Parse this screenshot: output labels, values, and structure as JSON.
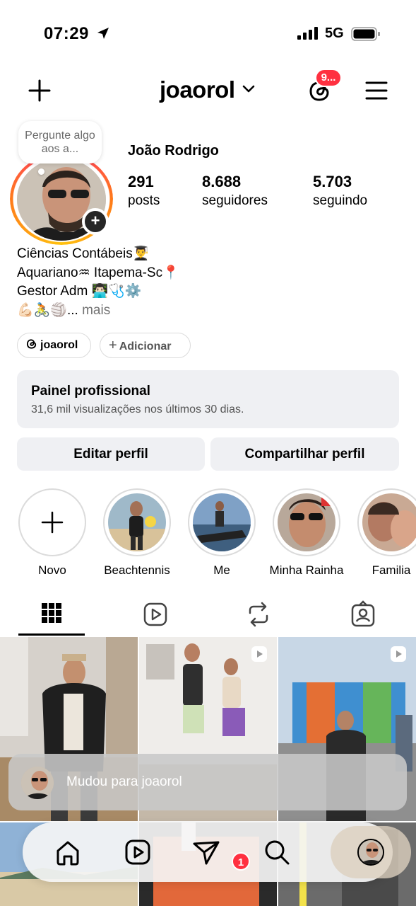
{
  "status_bar": {
    "time": "07:29",
    "network": "5G"
  },
  "header": {
    "username": "joaorol",
    "threads_badge": "9..."
  },
  "profile": {
    "note": "Pergunte algo aos a...",
    "display_name": "João Rodrigo",
    "stats": [
      {
        "value": "291",
        "label": "posts"
      },
      {
        "value": "8.688",
        "label": "seguidores"
      },
      {
        "value": "5.703",
        "label": "seguindo"
      }
    ],
    "bio_lines": [
      "Ciências Contábeis👨‍🎓",
      "Aquariano♒ Itapema-Sc📍",
      "Gestor Adm 👨🏻‍💻🩺⚙️",
      "💪🏻🚴🏐..."
    ],
    "bio_more": "mais",
    "threads_chip": "joaorol",
    "add_chip": "Adicionar"
  },
  "dashboard": {
    "title": "Painel profissional",
    "subtitle": "31,6 mil visualizações nos últimos 30 dias."
  },
  "buttons": {
    "edit": "Editar perfil",
    "share": "Compartilhar perfil"
  },
  "highlights": [
    {
      "label": "Novo"
    },
    {
      "label": "Beachtennis"
    },
    {
      "label": "Me"
    },
    {
      "label": "Minha Rainha"
    },
    {
      "label": "Familia"
    }
  ],
  "toast": {
    "text": "Mudou para joaorol"
  },
  "nav": {
    "messages_badge": "1"
  },
  "colors": {
    "accent_red": "#ff3040",
    "panel_bg": "#eff0f3"
  }
}
